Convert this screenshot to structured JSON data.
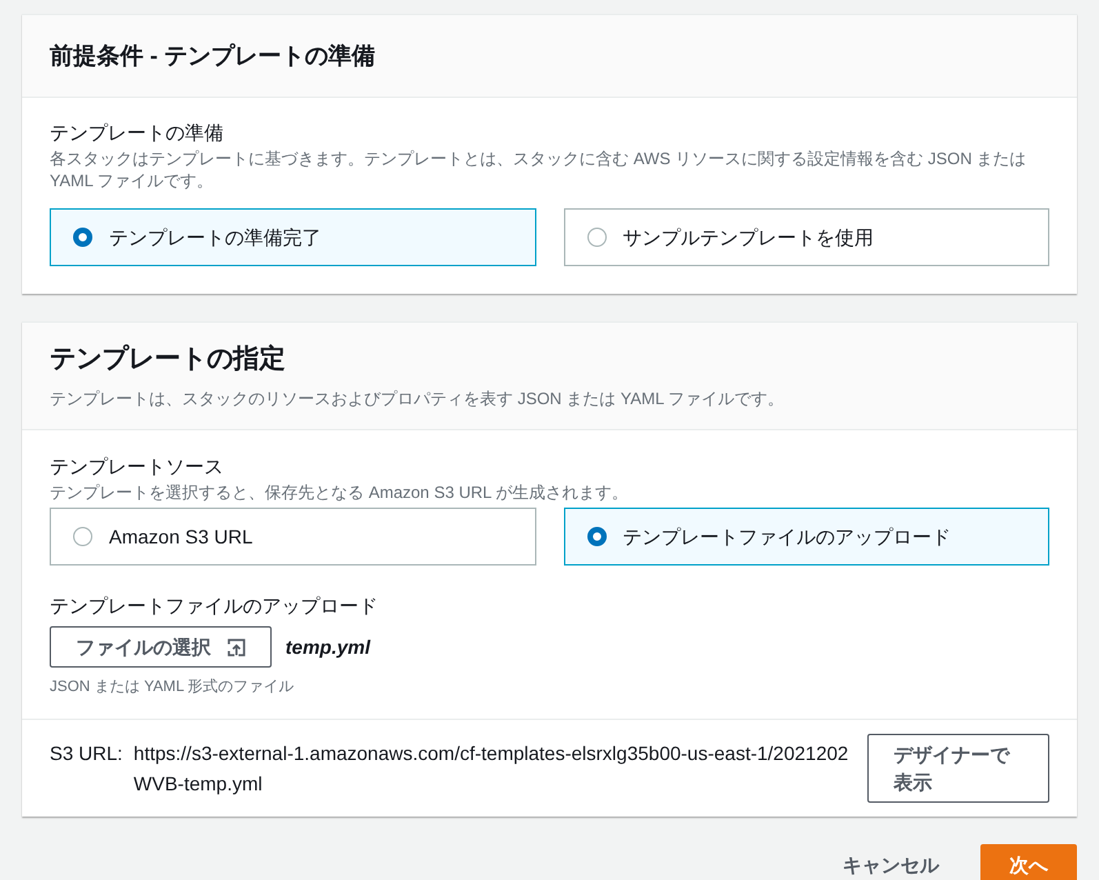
{
  "prerequisite": {
    "title": "前提条件 - テンプレートの準備",
    "field": {
      "label": "テンプレートの準備",
      "description": "各スタックはテンプレートに基づきます。テンプレートとは、スタックに含む AWS リソースに関する設定情報を含む JSON または YAML ファイルです。",
      "options": [
        {
          "label": "テンプレートの準備完了",
          "selected": true
        },
        {
          "label": "サンプルテンプレートを使用",
          "selected": false
        }
      ]
    }
  },
  "specify": {
    "title": "テンプレートの指定",
    "subtitle": "テンプレートは、スタックのリソースおよびプロパティを表す JSON または YAML ファイルです。",
    "source": {
      "label": "テンプレートソース",
      "description": "テンプレートを選択すると、保存先となる Amazon S3 URL が生成されます。",
      "options": [
        {
          "label": "Amazon S3 URL",
          "selected": false
        },
        {
          "label": "テンプレートファイルのアップロード",
          "selected": true
        }
      ]
    },
    "upload": {
      "label": "テンプレートファイルのアップロード",
      "button": "ファイルの選択",
      "file_name": "temp.yml",
      "hint": "JSON または YAML 形式のファイル"
    },
    "s3_url": {
      "label": "S3 URL:",
      "value": "https://s3-external-1.amazonaws.com/cf-templates-elsrxlg35b00-us-east-1/2021202WVB-temp.yml",
      "button": "デザイナーで表示"
    }
  },
  "footer": {
    "cancel": "キャンセル",
    "next": "次へ"
  }
}
